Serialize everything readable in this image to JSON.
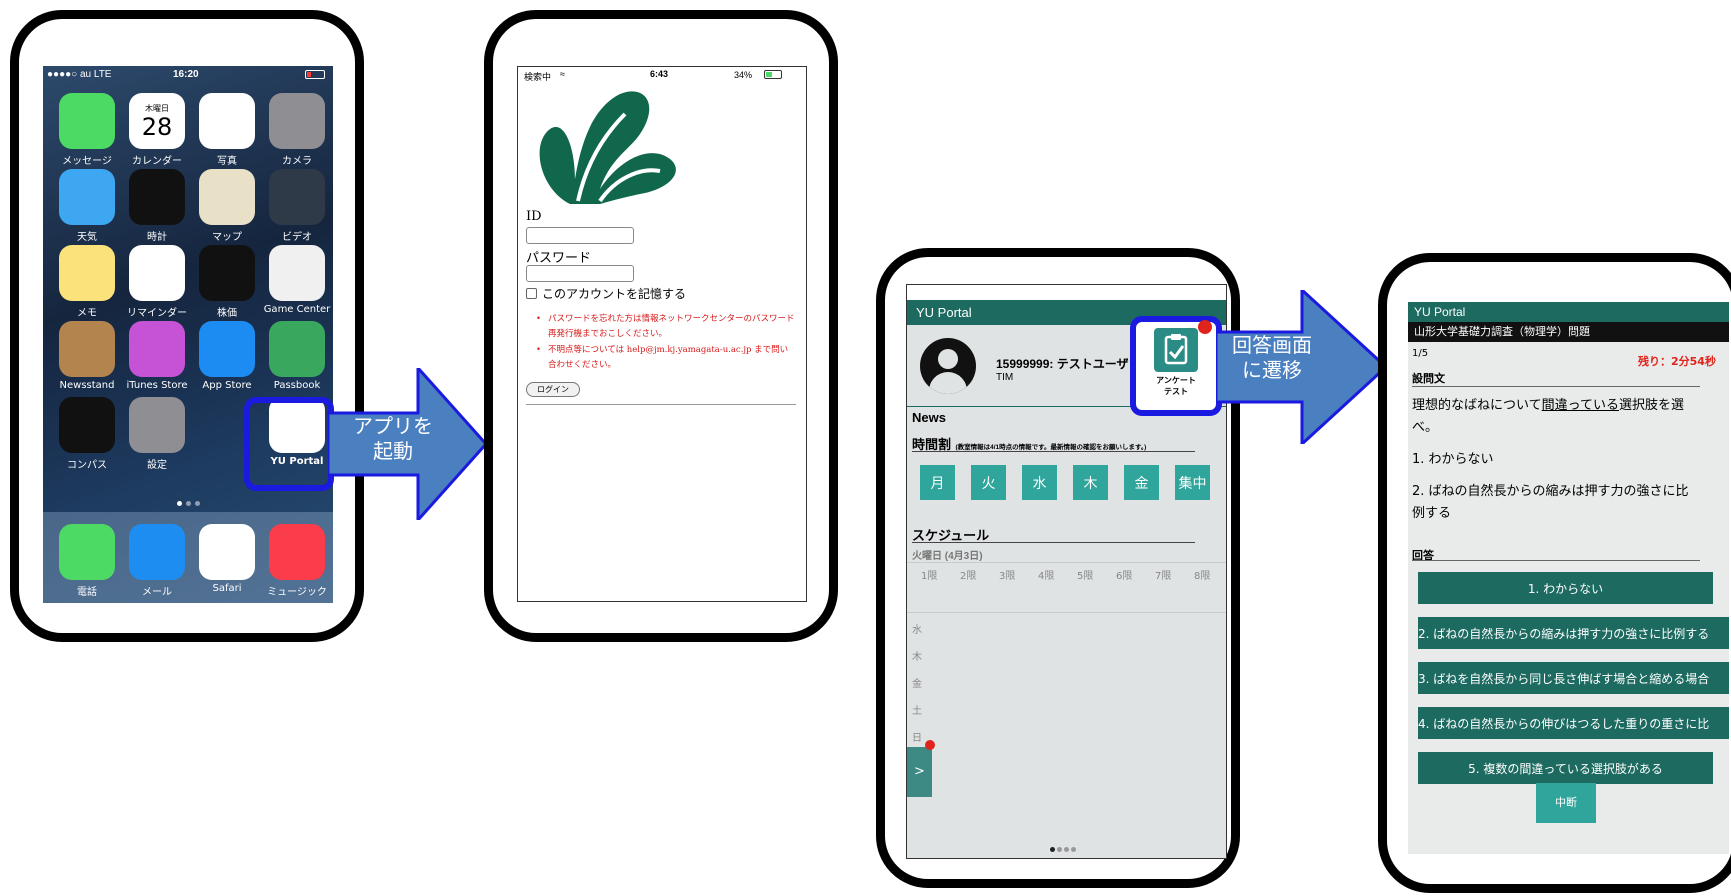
{
  "phone1": {
    "status": {
      "carrier": "●●●●○ au  LTE",
      "time": "16:20"
    },
    "apps": [
      {
        "label": "メッセージ",
        "icon": "messages-icon",
        "color": "#4cd964"
      },
      {
        "label": "カレンダー",
        "icon": "calendar-icon",
        "color": "#ffffff",
        "weekday": "木曜日",
        "day": "28"
      },
      {
        "label": "写真",
        "icon": "photos-icon",
        "color": "#ffffff"
      },
      {
        "label": "カメラ",
        "icon": "camera-icon",
        "color": "#8e8e93"
      },
      {
        "label": "天気",
        "icon": "weather-icon",
        "color": "#3ea7f1"
      },
      {
        "label": "時計",
        "icon": "clock-icon",
        "color": "#111111"
      },
      {
        "label": "マップ",
        "icon": "maps-icon",
        "color": "#e8e1c8"
      },
      {
        "label": "ビデオ",
        "icon": "video-icon",
        "color": "#2e3a48"
      },
      {
        "label": "メモ",
        "icon": "notes-icon",
        "color": "#fbe27a"
      },
      {
        "label": "リマインダー",
        "icon": "reminders-icon",
        "color": "#ffffff"
      },
      {
        "label": "株価",
        "icon": "stocks-icon",
        "color": "#111111"
      },
      {
        "label": "Game Center",
        "icon": "game-center-icon",
        "color": "#f0f0f0"
      },
      {
        "label": "Newsstand",
        "icon": "newsstand-icon",
        "color": "#b3844d"
      },
      {
        "label": "iTunes Store",
        "icon": "itunes-icon",
        "color": "#c653d6"
      },
      {
        "label": "App Store",
        "icon": "app-store-icon",
        "color": "#1d8cf2"
      },
      {
        "label": "Passbook",
        "icon": "passbook-icon",
        "color": "#39a85e"
      },
      {
        "label": "コンパス",
        "icon": "compass-icon",
        "color": "#111111"
      },
      {
        "label": "設定",
        "icon": "settings-icon",
        "color": "#8e8e93"
      },
      {
        "label": "YU Portal",
        "icon": "yu-portal-icon",
        "color": "#ffffff"
      }
    ],
    "dock": [
      {
        "label": "電話",
        "icon": "phone-icon",
        "color": "#4cd964"
      },
      {
        "label": "メール",
        "icon": "mail-icon",
        "color": "#1e8df1"
      },
      {
        "label": "Safari",
        "icon": "safari-icon",
        "color": "#ffffff"
      },
      {
        "label": "ミュージック",
        "icon": "music-icon",
        "color": "#fb3c4a"
      }
    ]
  },
  "arrow1": {
    "line1": "アプリを",
    "line2": "起動"
  },
  "phone2": {
    "status": {
      "left": "検索中",
      "time": "6:43",
      "battery": "34%"
    },
    "id_label": "ID",
    "password_label": "パスワード",
    "remember_label": "このアカウントを記憶する",
    "notes": [
      "パスワードを忘れた方は情報ネットワークセンターのパスワード再発行機までおこしください。",
      "不明点等については help@jm.kj.yamagata-u.ac.jp まで問い合わせください。"
    ],
    "login_button": "ログイン"
  },
  "phone3": {
    "header": "YU Portal",
    "user_id_name": "15999999: テストユーザ",
    "user_sub": "TIM",
    "survey_line1": "アンケート",
    "survey_line2": "テスト",
    "news_title": "News",
    "timetable_title": "時間割",
    "timetable_note": "(教室情報は4/1時点の情報です。最新情報の確認をお願いします。)",
    "days": [
      "月",
      "火",
      "水",
      "木",
      "金",
      "集中"
    ],
    "schedule_title": "スケジュール",
    "schedule_date": "火曜日 (4月3日)",
    "periods": [
      "1限",
      "2限",
      "3限",
      "4限",
      "5限",
      "6限",
      "7限",
      "8限"
    ],
    "side_days": [
      "水",
      "木",
      "金",
      "土",
      "日"
    ],
    "next_button": ">"
  },
  "arrow2": {
    "line1": "回答画面",
    "line2": "に遷移"
  },
  "phone4": {
    "header": "YU Portal",
    "subheader": "山形大学基礎力調査（物理学）問題",
    "progress": "1/5",
    "remaining": "残り：2分54秒",
    "question_label": "設問文",
    "question_pre": "理想的なばねについて",
    "question_underlined": "間違っている",
    "question_post": "選択肢を選べ。",
    "options": [
      "1. わからない",
      "2. ばねの自然長からの縮みは押す力の強さに比例する"
    ],
    "answer_label": "回答",
    "answers": [
      "1. わからない",
      "2. ばねの自然長からの縮みは押す力の強さに比例する",
      "3. ばねを自然長から同じ長さ伸ばす場合と縮める場合",
      "4. ばねの自然長からの伸びはつるした重りの重さに比",
      "5. 複数の間違っている選択肢がある"
    ],
    "stop_button": "中断"
  },
  "colors": {
    "arrow_fill": "#4a7fc0",
    "highlight": "#1a1ae0",
    "teal": "#1c6a60",
    "alert_red": "#e0241b"
  }
}
